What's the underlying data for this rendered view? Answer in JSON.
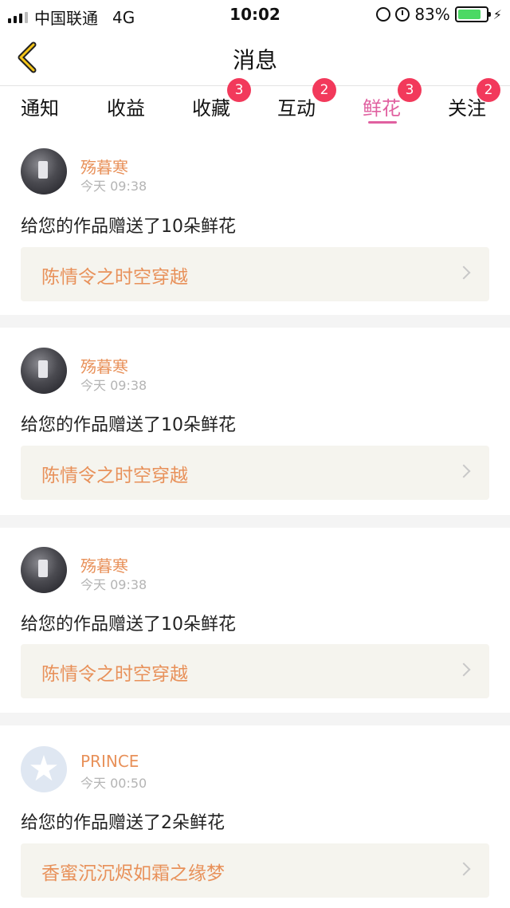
{
  "status_bar": {
    "carrier": "中国联通",
    "network": "4G",
    "time": "10:02",
    "battery": "83%",
    "battery_level": 0.83
  },
  "header": {
    "title": "消息"
  },
  "tabs": [
    {
      "label": "通知",
      "badge": ""
    },
    {
      "label": "收益",
      "badge": ""
    },
    {
      "label": "收藏",
      "badge": "3"
    },
    {
      "label": "互动",
      "badge": "2"
    },
    {
      "label": "鲜花",
      "badge": "3",
      "active": true
    },
    {
      "label": "关注",
      "badge": "2"
    }
  ],
  "messages": [
    {
      "username": "殇暮寒",
      "time": "今天 09:38",
      "text": "给您的作品赠送了10朵鲜花",
      "work": "陈情令之时空穿越",
      "avatar": "photo"
    },
    {
      "username": "殇暮寒",
      "time": "今天 09:38",
      "text": "给您的作品赠送了10朵鲜花",
      "work": "陈情令之时空穿越",
      "avatar": "photo"
    },
    {
      "username": "殇暮寒",
      "time": "今天 09:38",
      "text": "给您的作品赠送了10朵鲜花",
      "work": "陈情令之时空穿越",
      "avatar": "photo"
    },
    {
      "username": "PRINCE",
      "time": "今天 00:50",
      "text": "给您的作品赠送了2朵鲜花",
      "work": "香蜜沉沉烬如霜之缘梦",
      "avatar": "qq"
    }
  ],
  "colors": {
    "accent_pink": "#e060a0",
    "name_orange": "#e8915a",
    "badge_red": "#f2395b"
  }
}
